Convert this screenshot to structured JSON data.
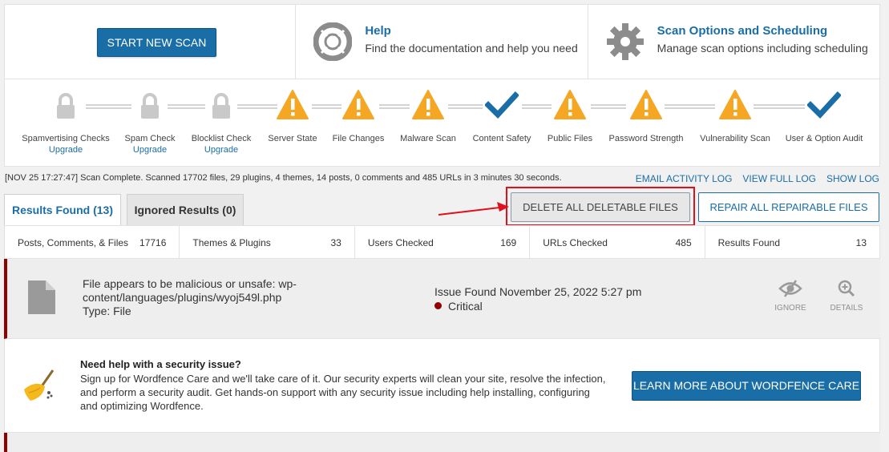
{
  "top": {
    "start_scan_label": "START NEW SCAN",
    "help": {
      "title": "Help",
      "subtitle": "Find the documentation and help you need",
      "icon": "lifebuoy-icon"
    },
    "options": {
      "title": "Scan Options and Scheduling",
      "subtitle": "Manage scan options including scheduling",
      "icon": "gear-icon"
    }
  },
  "stages": [
    {
      "label": "Spamvertising Checks",
      "upgrade": "Upgrade",
      "state": "locked"
    },
    {
      "label": "Spam Check",
      "upgrade": "Upgrade",
      "state": "locked"
    },
    {
      "label": "Blocklist Check",
      "upgrade": "Upgrade",
      "state": "locked"
    },
    {
      "label": "Server State",
      "state": "warning"
    },
    {
      "label": "File Changes",
      "state": "warning"
    },
    {
      "label": "Malware Scan",
      "state": "warning"
    },
    {
      "label": "Content Safety",
      "state": "complete"
    },
    {
      "label": "Public Files",
      "state": "warning"
    },
    {
      "label": "Password Strength",
      "state": "warning"
    },
    {
      "label": "Vulnerability Scan",
      "state": "warning"
    },
    {
      "label": "User & Option Audit",
      "state": "complete"
    }
  ],
  "log": {
    "message": "[NOV 25 17:27:47] Scan Complete. Scanned 17702 files, 29 plugins, 4 themes, 14 posts, 0 comments and 485 URLs in 3 minutes 30 seconds.",
    "email_label": "EMAIL ACTIVITY LOG",
    "full_label": "VIEW FULL LOG",
    "show_label": "SHOW LOG"
  },
  "tabs": {
    "results": "Results Found (13)",
    "ignored": "Ignored Results (0)"
  },
  "actions": {
    "delete_all": "DELETE ALL DELETABLE FILES",
    "repair_all": "REPAIR ALL REPAIRABLE FILES"
  },
  "stats": [
    {
      "label": "Posts, Comments, & Files",
      "value": "17716"
    },
    {
      "label": "Themes & Plugins",
      "value": "33"
    },
    {
      "label": "Users Checked",
      "value": "169"
    },
    {
      "label": "URLs Checked",
      "value": "485"
    },
    {
      "label": "Results Found",
      "value": "13"
    }
  ],
  "issue": {
    "line1": "File appears to be malicious or unsafe: wp-",
    "line2": "content/languages/plugins/wyoj549l.php",
    "line3": "Type: File",
    "found": "Issue Found November 25, 2022 5:27 pm",
    "severity": "Critical",
    "ignore_label": "IGNORE",
    "details_label": "DETAILS"
  },
  "care": {
    "title": "Need help with a security issue?",
    "body": "Sign up for Wordfence Care and we'll take care of it. Our security experts will clean your site, resolve the infection, and perform a security audit. Get hands-on support with any security issue including help installing, configuring and optimizing Wordfence.",
    "button": "LEARN MORE ABOUT WORDFENCE CARE"
  },
  "colors": {
    "accent": "#1a6ea7",
    "warning": "#f5a623",
    "check": "#1a6ea7",
    "critical": "#930000",
    "annotation": "#e0101b"
  }
}
